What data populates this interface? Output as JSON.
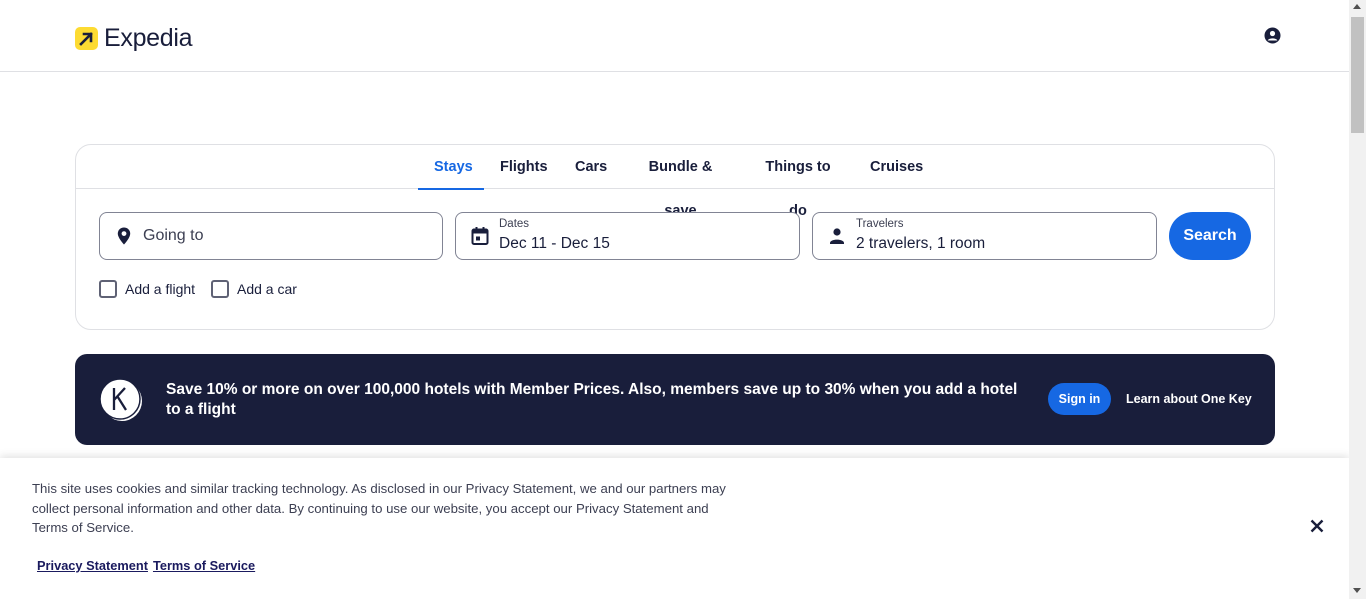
{
  "header": {
    "logo_text": "Expedia",
    "account_icon": "account-circle-icon"
  },
  "tabs": [
    {
      "label": "Stays",
      "active": true
    },
    {
      "label": "Flights",
      "active": false
    },
    {
      "label": "Cars",
      "active": false
    },
    {
      "label": "Bundle & save",
      "active": false
    },
    {
      "label": "Things to do",
      "active": false
    },
    {
      "label": "Cruises",
      "active": false
    }
  ],
  "search": {
    "destination_placeholder": "Going to",
    "dates_label": "Dates",
    "dates_value": "Dec 11 - Dec 15",
    "travelers_label": "Travelers",
    "travelers_value": "2 travelers, 1 room",
    "search_button": "Search",
    "add_flight_label": "Add a flight",
    "add_car_label": "Add a car"
  },
  "banner": {
    "text": "Save 10% or more on over 100,000 hotels with Member Prices. Also, members save up to 30% when you add a hotel to a flight",
    "signin_label": "Sign in",
    "learn_label": "Learn about One Key"
  },
  "cookie": {
    "text": "This site uses cookies and similar tracking technology. As disclosed in our Privacy Statement, we and our partners may collect personal information and other data. By continuing to use our website, you accept our Privacy Statement and Terms of Service.",
    "privacy_link": "Privacy Statement",
    "terms_link": "Terms of Service"
  },
  "colors": {
    "accent": "#1668e3",
    "banner_bg": "#191e3b",
    "logo_yellow": "#fddb32"
  }
}
